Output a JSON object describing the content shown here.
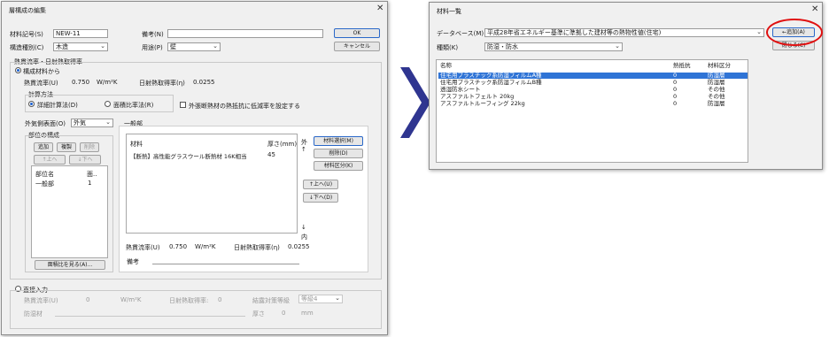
{
  "left_dialog": {
    "title": "層構成の編集",
    "close": "✕",
    "material_no_label": "材料記号(S)",
    "material_no_value": "NEW-11",
    "structure_label": "構造種別(C)",
    "structure_value": "木造",
    "note_label": "備考(N)",
    "note_value": "",
    "use_label": "用途(P)",
    "use_value": "壁",
    "ok": "OK",
    "cancel": "キャンセル",
    "heat_group_title": "熱貫流率・日射熱取得率",
    "radio_composition": "構成材料から",
    "u_label": "熱貫流率(U)",
    "u_value": "0.750",
    "u_unit": "W/m²K",
    "eta_label": "日射熱取得率(η)",
    "eta_value": "0.0255",
    "calc_method_title": "計算方法",
    "radio_detailed": "詳細計算法(D)",
    "radio_area_ratio": "面積比率法(R)",
    "exterior_check": "外張断熱材の熱抵抗に低減率を設定する",
    "exterior_surface_label": "外気側表面(O)",
    "exterior_surface_value": "外気",
    "parts_title": "部位の構成",
    "add_button": "追加",
    "copy_button": "複製",
    "delete_button": "削除",
    "up_button": "↑上へ",
    "down_button": "↓下へ",
    "parts_header_name": "部位名",
    "parts_header_area": "面..",
    "parts_rows": [
      {
        "name": "一般部",
        "area": "1"
      }
    ],
    "area_ratio_button": "面積比を見る(A)...",
    "general_title": "一般部",
    "table_header_material": "材料",
    "table_header_thickness": "厚さ(mm)",
    "layers": [
      {
        "material": "【断熱】高性能グラスウール断熱材 16K相当",
        "thickness": "45"
      }
    ],
    "outside_label": "外",
    "inside_label": "内",
    "arrow_up": "↑",
    "arrow_down": "↓",
    "select_material_button": "材料選択(M)",
    "delete_layer_button": "削除(D)",
    "material_class_button": "材料区分(K)",
    "layer_up_button": "↑上へ(U)",
    "layer_down_button": "↓下へ(D)",
    "general_u_label": "熱貫流率(U)",
    "general_u_value": "0.750",
    "general_u_unit": "W/m²K",
    "general_eta_label": "日射熱取得率(η)",
    "general_eta_value": "0.0255",
    "general_note_label": "備考",
    "direct_radio": "直接入力",
    "direct_u_label": "熱貫流率(U)",
    "direct_u_value": "0",
    "direct_u_unit": "W/m²K",
    "direct_eta_label": "日射熱取得率:",
    "direct_eta_value": "0",
    "grade_label": "結露対策等級",
    "grade_value": "等級4",
    "moisture_label": "防湿材",
    "thickness_label": "厚さ",
    "thickness_value": "0",
    "thickness_unit": "mm"
  },
  "arrow": {
    "color": "#2f3590"
  },
  "right_dialog": {
    "title": "材料一覧",
    "close": "✕",
    "database_label": "データベース(M)",
    "database_value": "平成28年省エネルギー基準に準拠した建材等の熱物性値(住宅)",
    "kind_label": "種類(K)",
    "kind_value": "防湿・防水",
    "add_button": "←追加(A)",
    "close_button": "閉じる(C)",
    "header_name": "名称",
    "header_resistance": "熱抵抗",
    "header_class": "材料区分",
    "rows": [
      {
        "name": "住宅用プラスチック系防湿フィルムA種",
        "resistance": "0",
        "class": "防湿層",
        "selected": true
      },
      {
        "name": "住宅用プラスチック系防湿フィルムB種",
        "resistance": "0",
        "class": "防湿層",
        "selected": false
      },
      {
        "name": "透湿防水シート",
        "resistance": "0",
        "class": "その他",
        "selected": false
      },
      {
        "name": "アスファルトフェルト 20kg",
        "resistance": "0",
        "class": "その他",
        "selected": false
      },
      {
        "name": "アスファルトルーフィング 22kg",
        "resistance": "0",
        "class": "防湿層",
        "selected": false
      }
    ],
    "highlight_color": "#e01010"
  }
}
